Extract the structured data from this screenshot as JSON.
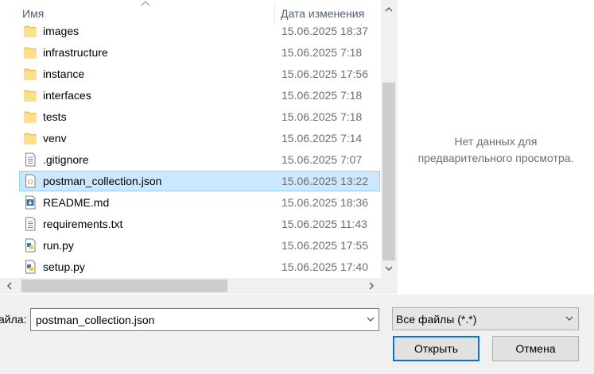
{
  "header": {
    "name_col": "Имя",
    "date_col": "Дата изменения"
  },
  "files": [
    {
      "name": "images",
      "date": "15.06.2025 18:37",
      "icon": "folder-icon"
    },
    {
      "name": "infrastructure",
      "date": "15.06.2025 7:18",
      "icon": "folder-icon"
    },
    {
      "name": "instance",
      "date": "15.06.2025 17:56",
      "icon": "folder-icon"
    },
    {
      "name": "interfaces",
      "date": "15.06.2025 7:18",
      "icon": "folder-icon"
    },
    {
      "name": "tests",
      "date": "15.06.2025 7:18",
      "icon": "folder-icon"
    },
    {
      "name": "venv",
      "date": "15.06.2025 7:14",
      "icon": "folder-icon"
    },
    {
      "name": ".gitignore",
      "date": "15.06.2025 7:07",
      "icon": "text-file-icon"
    },
    {
      "name": "postman_collection.json",
      "date": "15.06.2025 13:22",
      "icon": "json-file-icon",
      "selected": true
    },
    {
      "name": "README.md",
      "date": "15.06.2025 18:36",
      "icon": "markdown-file-icon"
    },
    {
      "name": "requirements.txt",
      "date": "15.06.2025 11:43",
      "icon": "text-file-icon"
    },
    {
      "name": "run.py",
      "date": "15.06.2025 17:55",
      "icon": "python-file-icon"
    },
    {
      "name": "setup.py",
      "date": "15.06.2025 17:40",
      "icon": "python-file-icon"
    }
  ],
  "preview": {
    "line1": "Нет данных для",
    "line2": "предварительного просмотра."
  },
  "filename": {
    "label": "айла:",
    "value": "postman_collection.json"
  },
  "filter": {
    "value": "Все файлы (*.*)"
  },
  "buttons": {
    "open": "Открыть",
    "cancel": "Отмена"
  },
  "colors": {
    "selection": "#cce8ff",
    "selection_border": "#99d1ff",
    "folder": "#ffd767",
    "accent": "#0078d7"
  }
}
